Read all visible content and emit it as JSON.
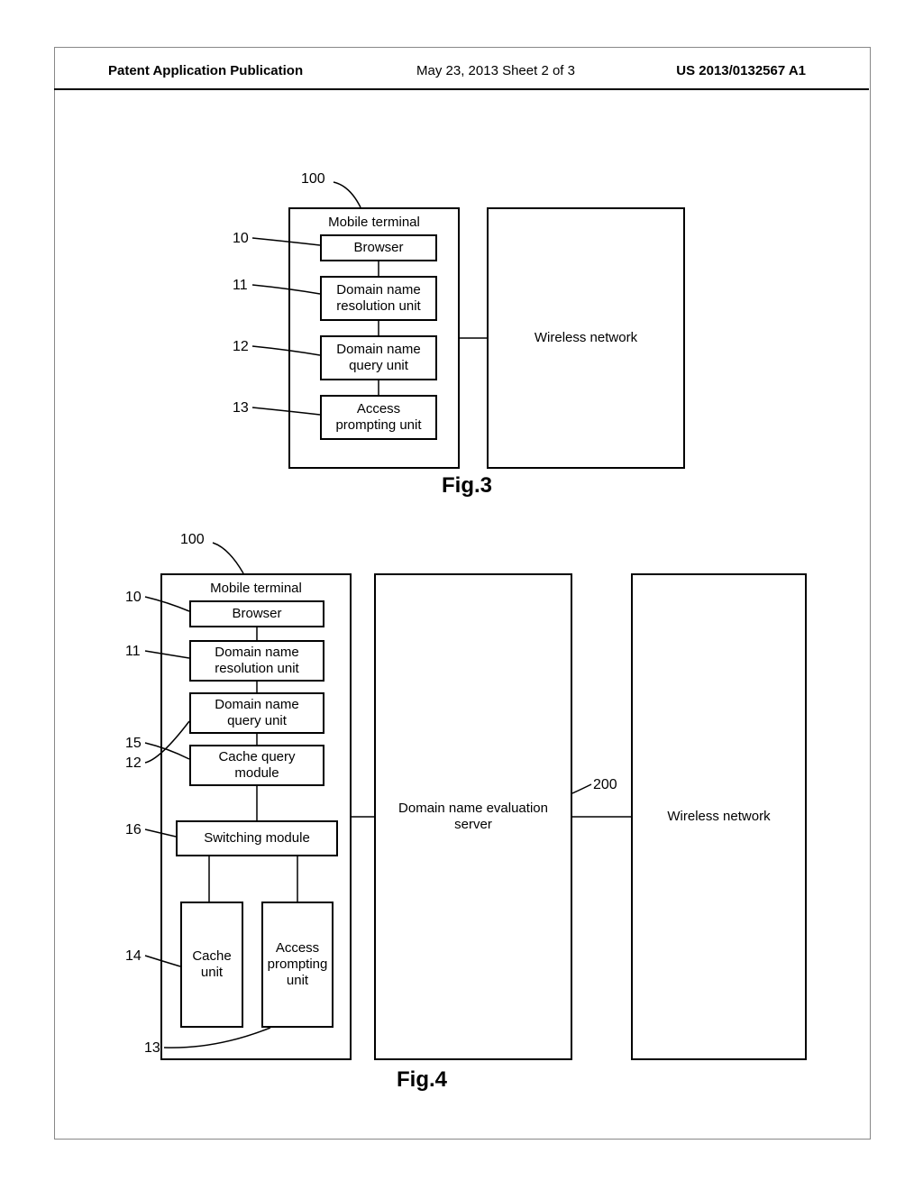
{
  "header": {
    "left": "Patent Application Publication",
    "mid": "May 23, 2013   Sheet 2 of 3",
    "right": "US 2013/0132567 A1"
  },
  "fig3": {
    "caption": "Fig.3",
    "ref_mobile": "100",
    "ref_browser": "10",
    "ref_dnru": "11",
    "ref_dnqu": "12",
    "ref_apu": "13",
    "mobile_terminal": "Mobile terminal",
    "browser": "Browser",
    "dnru": "Domain name resolution unit",
    "dnqu": "Domain name query unit",
    "apu": "Access prompting unit",
    "wireless": "Wireless network"
  },
  "fig4": {
    "caption": "Fig.4",
    "ref_mobile": "100",
    "ref_browser": "10",
    "ref_dnru": "11",
    "ref_dnqu": "12",
    "ref_cqm": "15",
    "ref_swm": "16",
    "ref_cache": "14",
    "ref_apu": "13",
    "ref_dns_server": "200",
    "mobile_terminal": "Mobile terminal",
    "browser": "Browser",
    "dnru": "Domain name resolution unit",
    "dnqu": "Domain name query unit",
    "cqm": "Cache query module",
    "swm": "Switching module",
    "cache": "Cache unit",
    "apu": "Access prompting unit",
    "dns_server": "Domain name evaluation server",
    "wireless": "Wireless network"
  }
}
